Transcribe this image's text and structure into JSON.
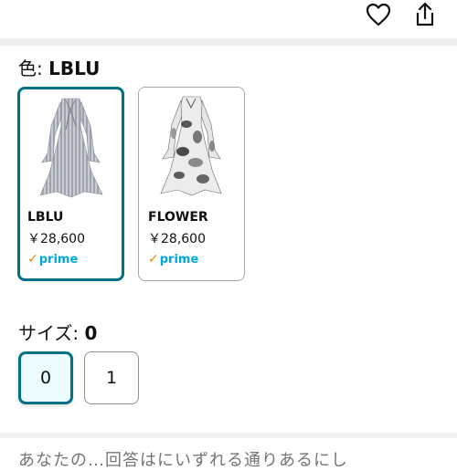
{
  "colors": {
    "accent": "#007185",
    "selected_bg": "#edfdff",
    "prime_blue": "#00a8e1",
    "prime_check": "#f08804"
  },
  "header": {
    "icons": [
      "heart-icon",
      "share-icon"
    ]
  },
  "color_selector": {
    "label": "色: ",
    "selected_value": "LBLU",
    "options": [
      {
        "name": "LBLU",
        "price": "￥28,600",
        "prime": "prime",
        "selected": true
      },
      {
        "name": "FLOWER",
        "price": "￥28,600",
        "prime": "prime",
        "selected": false
      }
    ]
  },
  "size_selector": {
    "label": "サイズ: ",
    "selected_value": "0",
    "options": [
      {
        "label": "0",
        "selected": true
      },
      {
        "label": "1",
        "selected": false
      }
    ]
  },
  "cutoff_text": "あなたの…回答はにいずれる通りあるにし"
}
